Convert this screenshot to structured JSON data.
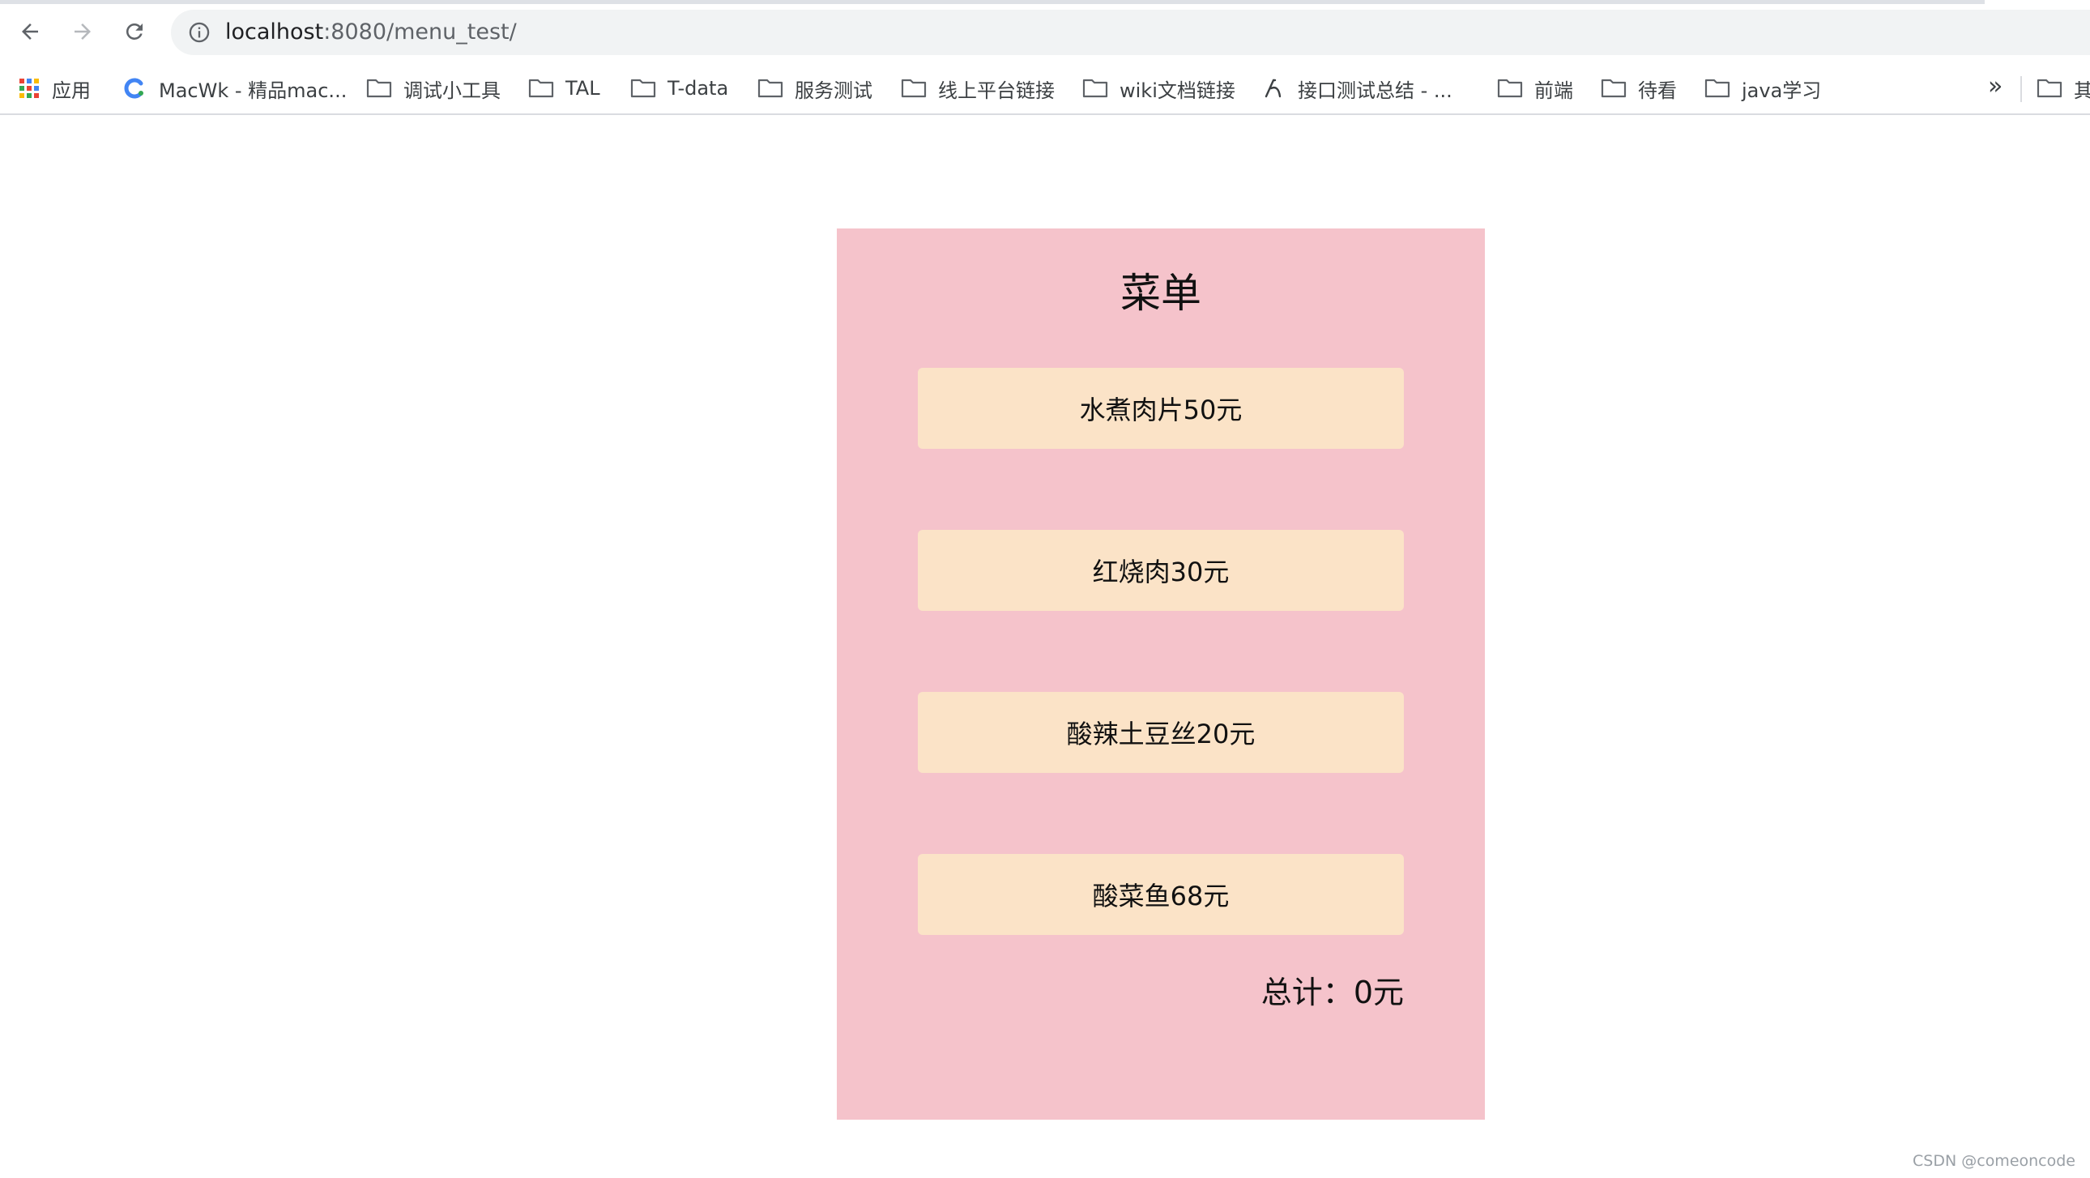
{
  "browser": {
    "url_host": "localhost",
    "url_path": ":8080/menu_test/"
  },
  "bookmarks": [
    {
      "label": "应用",
      "icon": "apps-grid-icon"
    },
    {
      "label": "MacWk - 精品mac...",
      "icon": "macwk-logo-icon"
    },
    {
      "label": "调试小工具",
      "icon": "folder-icon"
    },
    {
      "label": "TAL",
      "icon": "folder-icon"
    },
    {
      "label": "T-data",
      "icon": "folder-icon"
    },
    {
      "label": "服务测试",
      "icon": "folder-icon"
    },
    {
      "label": "线上平台链接",
      "icon": "folder-icon"
    },
    {
      "label": "wiki文档链接",
      "icon": "folder-icon"
    },
    {
      "label": "接口测试总结 - ...",
      "icon": "page-icon"
    },
    {
      "label": "前端",
      "icon": "folder-icon"
    },
    {
      "label": "待看",
      "icon": "folder-icon"
    },
    {
      "label": "java学习",
      "icon": "folder-icon"
    }
  ],
  "bookmarks_overflow": "»",
  "bookmarks_trailing": "其",
  "menu": {
    "title": "菜单",
    "items": [
      {
        "label": "水煮肉片50元"
      },
      {
        "label": "红烧肉30元"
      },
      {
        "label": "酸辣土豆丝20元"
      },
      {
        "label": "酸菜鱼68元"
      }
    ],
    "total_label": "总计：",
    "total_value": "0元"
  },
  "colors": {
    "card_background": "#f5c3cb",
    "item_background": "#fbe3c7"
  },
  "watermark": "CSDN @comeoncode"
}
